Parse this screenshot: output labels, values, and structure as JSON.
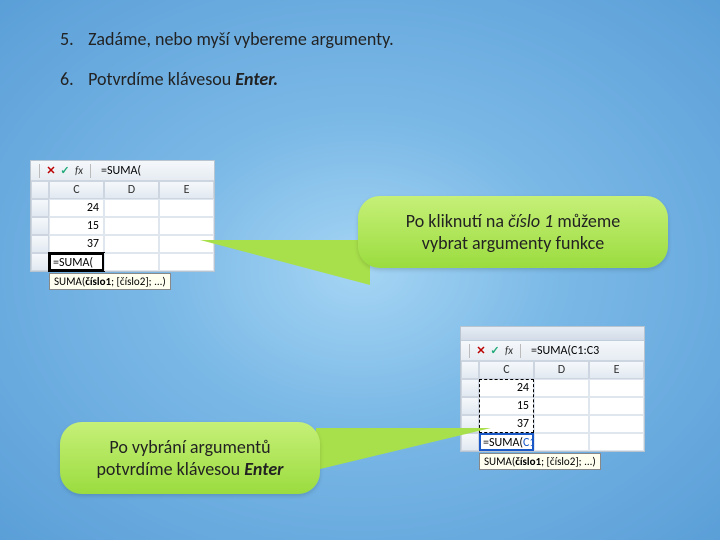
{
  "instructions": {
    "item5": {
      "num": "5.",
      "text_a": "Zadáme, nebo myší vybereme argumenty."
    },
    "item6": {
      "num": "6.",
      "text_a": "Potvrdíme klávesou ",
      "text_b": "Enter."
    }
  },
  "excel1": {
    "formula": "=SUMA(",
    "cols": {
      "c": "C",
      "d": "D",
      "e": "E"
    },
    "vals": {
      "r1": "24",
      "r2": "15",
      "r3": "37"
    },
    "active": "=SUMA(",
    "tooltip_parts": {
      "fn": "SUMA(",
      "b": "číslo1",
      "rest": "; [číslo2]; ...)"
    }
  },
  "callout1": {
    "l1_a": "Po kliknutí na ",
    "l1_b": "číslo 1",
    "l1_c": " můžeme",
    "l2": "vybrat argumenty funkce"
  },
  "callout2": {
    "l1": "Po vybrání argumentů",
    "l2_a": "potvrdíme klávesou ",
    "l2_b": "Enter"
  },
  "excel2": {
    "formula": "=SUMA(C1:C3",
    "cols": {
      "c": "C",
      "d": "D",
      "e": "E"
    },
    "vals": {
      "r1": "24",
      "r2": "15",
      "r3": "37"
    },
    "active_a": "=SUMA(",
    "active_b": "C1:C3",
    "tooltip_parts": {
      "fn": "SUMA(",
      "b": "číslo1",
      "rest": "; [číslo2]; ...)"
    }
  },
  "icons": {
    "cancel": "✕",
    "check": "✓",
    "fx": "fx"
  }
}
